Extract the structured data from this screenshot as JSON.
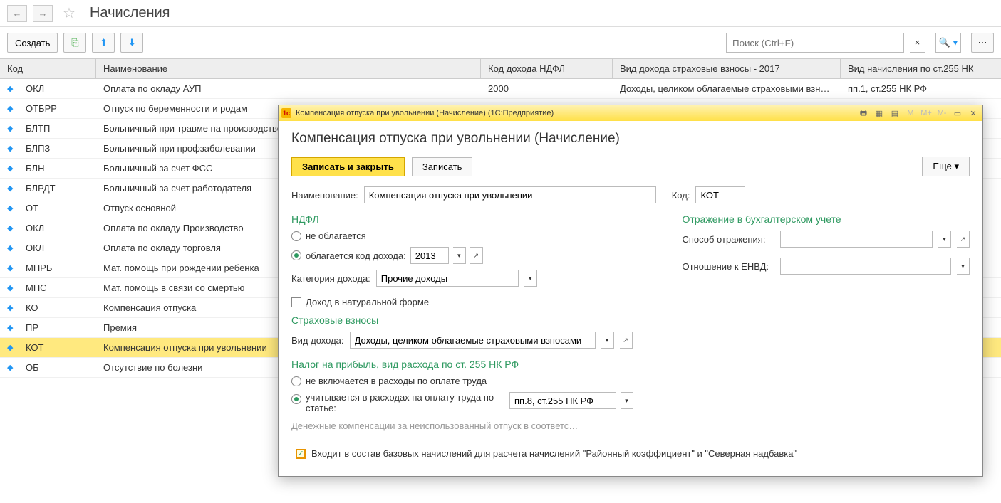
{
  "header": {
    "title": "Начисления"
  },
  "toolbar": {
    "create": "Создать",
    "search_placeholder": "Поиск (Ctrl+F)"
  },
  "grid": {
    "headers": {
      "code": "Код",
      "name": "Наименование",
      "ndfl": "Код дохода НДФЛ",
      "insurance": "Вид дохода страховые взносы - 2017",
      "art255": "Вид начисления по ст.255 НК"
    },
    "rows": [
      {
        "code": "ОКЛ",
        "name": "Оплата по окладу АУП",
        "ndfl": "2000",
        "ins": "Доходы, целиком облагаемые страховыми взн…",
        "art255": "пп.1, ст.255 НК РФ",
        "sel": false
      },
      {
        "code": "ОТБРР",
        "name": "Отпуск по беременности и родам",
        "ndfl": "",
        "ins": "",
        "art255": "",
        "sel": false
      },
      {
        "code": "БЛТП",
        "name": "Больничный при травме на производстве",
        "ndfl": "",
        "ins": "",
        "art255": "",
        "sel": false
      },
      {
        "code": "БЛПЗ",
        "name": "Больничный при профзаболевании",
        "ndfl": "",
        "ins": "",
        "art255": "",
        "sel": false
      },
      {
        "code": "БЛН",
        "name": "Больничный за счет ФСС",
        "ndfl": "",
        "ins": "",
        "art255": "",
        "sel": false
      },
      {
        "code": "БЛРДТ",
        "name": "Больничный за счет работодателя",
        "ndfl": "",
        "ins": "",
        "art255": "",
        "sel": false
      },
      {
        "code": "ОТ",
        "name": "Отпуск основной",
        "ndfl": "",
        "ins": "",
        "art255": "",
        "sel": false
      },
      {
        "code": "ОКЛ",
        "name": "Оплата по окладу Производство",
        "ndfl": "",
        "ins": "",
        "art255": "",
        "sel": false
      },
      {
        "code": "ОКЛ",
        "name": "Оплата по окладу торговля",
        "ndfl": "",
        "ins": "",
        "art255": "",
        "sel": false
      },
      {
        "code": "МПРБ",
        "name": "Мат. помощь при рождении ребенка",
        "ndfl": "",
        "ins": "",
        "art255": "",
        "sel": false
      },
      {
        "code": "МПС",
        "name": "Мат. помощь в связи со смертью",
        "ndfl": "",
        "ins": "",
        "art255": "",
        "sel": false
      },
      {
        "code": "КО",
        "name": "Компенсация отпуска",
        "ndfl": "",
        "ins": "",
        "art255": "",
        "sel": false
      },
      {
        "code": "ПР",
        "name": "Премия",
        "ndfl": "",
        "ins": "",
        "art255": "",
        "sel": false
      },
      {
        "code": "КОТ",
        "name": "Компенсация отпуска при увольнении",
        "ndfl": "",
        "ins": "",
        "art255": "",
        "sel": true
      },
      {
        "code": "ОБ",
        "name": "Отсутствие по болезни",
        "ndfl": "",
        "ins": "",
        "art255": "",
        "sel": false
      }
    ]
  },
  "dialog": {
    "titlebar": "Компенсация отпуска при увольнении (Начисление)  (1С:Предприятие)",
    "heading": "Компенсация отпуска при увольнении (Начисление)",
    "btn_save_close": "Записать и закрыть",
    "btn_save": "Записать",
    "btn_more": "Еще",
    "name_label": "Наименование:",
    "name_value": "Компенсация отпуска при увольнении",
    "code_label": "Код:",
    "code_value": "КОТ",
    "ndfl": {
      "title": "НДФЛ",
      "opt_notax": "не облагается",
      "opt_tax": "облагается   код дохода:",
      "income_code": "2013",
      "category_label": "Категория дохода:",
      "category_value": "Прочие доходы",
      "natural": "Доход в натуральной форме"
    },
    "insurance": {
      "title": "Страховые взносы",
      "type_label": "Вид дохода:",
      "type_value": "Доходы, целиком облагаемые страховыми взносами"
    },
    "profit": {
      "title": "Налог на прибыль, вид расхода по ст. 255 НК РФ",
      "opt_excl": "не включается в расходы по оплате труда",
      "opt_incl": "учитывается в расходах на оплату труда по статье:",
      "article_value": "пп.8, ст.255 НК РФ",
      "hint": "Денежные компенсации за неиспользованный отпуск в соответс…"
    },
    "accounting": {
      "title": "Отражение в бухгалтерском учете",
      "method_label": "Способ отражения:",
      "envd_label": "Отношение к ЕНВД:"
    },
    "base_check": "Входит в состав базовых начислений для расчета начислений \"Районный коэффициент\" и \"Северная надбавка\""
  }
}
